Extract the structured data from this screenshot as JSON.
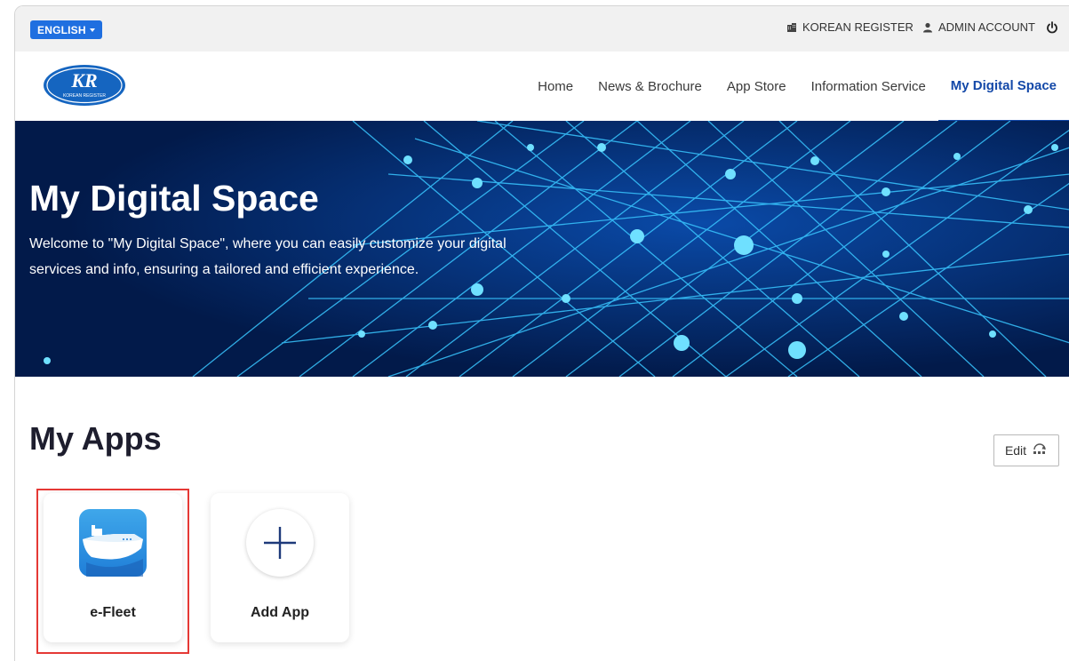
{
  "topbar": {
    "language_label": "ENGLISH",
    "org_label": "KOREAN REGISTER",
    "account_label": "ADMIN ACCOUNT"
  },
  "logo": {
    "text": "KR",
    "subtext": "KOREAN REGISTER"
  },
  "nav": {
    "items": [
      {
        "label": "Home"
      },
      {
        "label": "News & Brochure"
      },
      {
        "label": "App Store"
      },
      {
        "label": "Information Service"
      },
      {
        "label": "My Digital Space"
      }
    ],
    "active": "My Digital Space"
  },
  "hero": {
    "title": "My Digital Space",
    "description": "Welcome to \"My Digital Space\", where you can easily customize your digital services and info, ensuring a tailored and efficient experience."
  },
  "apps": {
    "title": "My Apps",
    "edit_label": "Edit",
    "items": [
      {
        "label": "e-Fleet",
        "icon": "ship-icon"
      },
      {
        "label": "Add App",
        "icon": "plus-icon"
      }
    ]
  },
  "colors": {
    "accent": "#1f6fe0",
    "nav_active": "#1348a8",
    "hero_bg": "#021a4a",
    "highlight": "#e53935"
  }
}
